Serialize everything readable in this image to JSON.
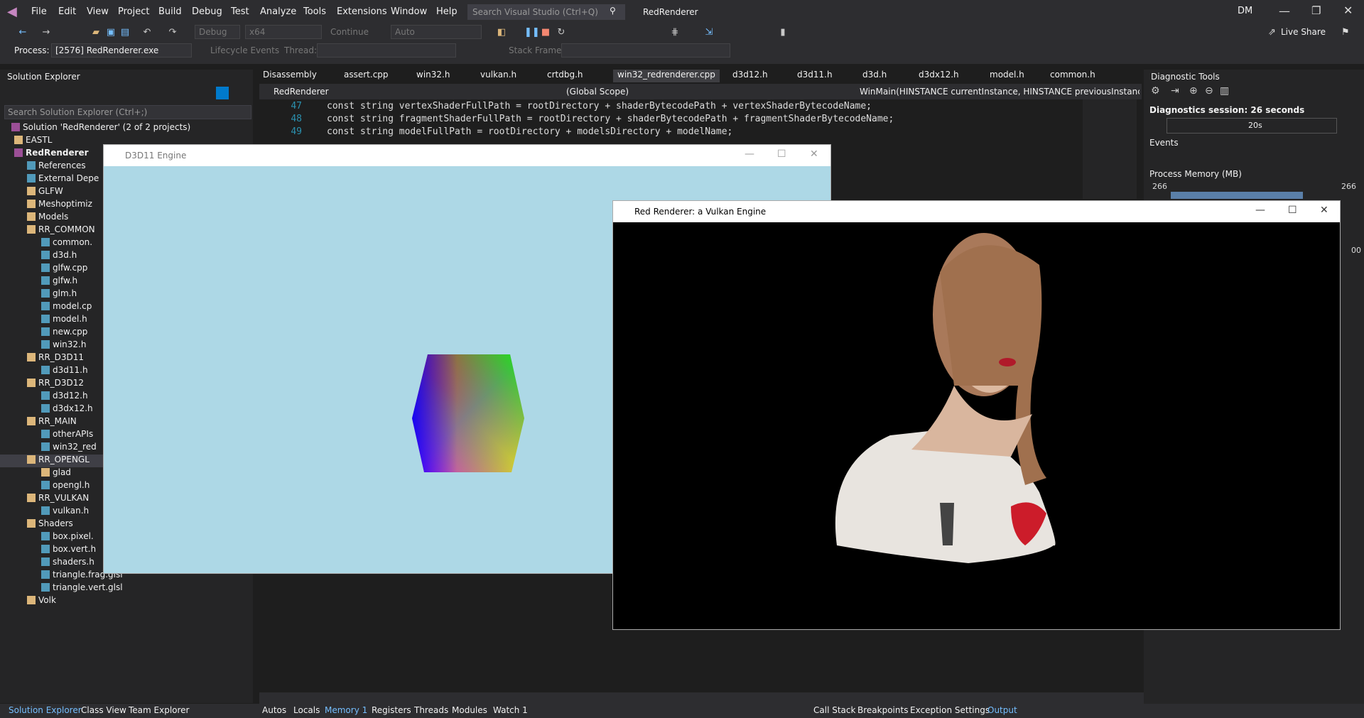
{
  "titlebar": {
    "menus": [
      "File",
      "Edit",
      "View",
      "Project",
      "Build",
      "Debug",
      "Test",
      "Analyze",
      "Tools",
      "Extensions",
      "Window",
      "Help"
    ],
    "search_placeholder": "Search Visual Studio (Ctrl+Q)",
    "solution_name": "RedRenderer",
    "user_initials": "DM"
  },
  "toolbar": {
    "config": "Debug",
    "platform": "x64",
    "continue": "Continue",
    "auto": "Auto",
    "live_share": "Live Share",
    "process_label": "Process:",
    "process_value": "[2576] RedRenderer.exe",
    "lifecycle": "Lifecycle Events",
    "thread_label": "Thread:",
    "stack_frame_label": "Stack Frame:"
  },
  "solution_explorer": {
    "title": "Solution Explorer",
    "search": "Search Solution Explorer (Ctrl+;)",
    "items": [
      "Solution 'RedRenderer' (2 of 2 projects)",
      "EASTL",
      "RedRenderer",
      "References",
      "External Depe",
      "GLFW",
      "Meshoptimiz",
      "Models",
      "RR_COMMON",
      "common.",
      "d3d.h",
      "glfw.cpp",
      "glfw.h",
      "glm.h",
      "model.cp",
      "model.h",
      "new.cpp",
      "win32.h",
      "RR_D3D11",
      "d3d11.h",
      "RR_D3D12",
      "d3d12.h",
      "d3dx12.h",
      "RR_MAIN",
      "otherAPIs",
      "win32_red",
      "RR_OPENGL",
      "glad",
      "opengl.h",
      "RR_VULKAN",
      "vulkan.h",
      "Shaders",
      "box.pixel.",
      "box.vert.h",
      "shaders.h",
      "triangle.frag.glsl",
      "triangle.vert.glsl",
      "Volk"
    ]
  },
  "editor": {
    "tabs": [
      "Disassembly",
      "assert.cpp",
      "win32.h",
      "vulkan.h",
      "crtdbg.h",
      "win32_redrenderer.cpp",
      "d3d12.h",
      "d3d11.h",
      "d3d.h",
      "d3dx12.h",
      "model.h",
      "common.h"
    ],
    "nav_project": "RedRenderer",
    "nav_scope": "(Global Scope)",
    "nav_func": "WinMain(HINSTANCE currentInstance, HINSTANCE previousInstance, L",
    "lines": [
      {
        "n": "47",
        "code": "const string vertexShaderFullPath = rootDirectory + shaderBytecodePath + vertexShaderBytecodeName;"
      },
      {
        "n": "48",
        "code": "const string fragmentShaderFullPath = rootDirectory + shaderBytecodePath + fragmentShaderBytecodeName;"
      },
      {
        "n": "49",
        "code": "const string modelFullPath = rootDirectory + modelsDirectory + modelName;"
      }
    ]
  },
  "diag": {
    "title": "Diagnostic Tools",
    "session": "Diagnostics session: 26 seconds",
    "tick": "20s",
    "events": "Events",
    "memory": "Process Memory (MB)",
    "mem_left": "266",
    "mem_right": "266",
    "side_val": "00"
  },
  "d3d_window": {
    "title": "D3D11 Engine",
    "bg": "#add8e6"
  },
  "vk_window": {
    "title": "Red Renderer: a Vulkan Engine"
  },
  "status": {
    "left": [
      "Solution Explorer",
      "Class View",
      "Team Explorer"
    ],
    "mid": [
      "Autos",
      "Locals",
      "Memory 1",
      "Registers",
      "Threads",
      "Modules",
      "Watch 1"
    ],
    "right": [
      "Call Stack",
      "Breakpoints",
      "Exception Settings",
      "Output"
    ]
  }
}
